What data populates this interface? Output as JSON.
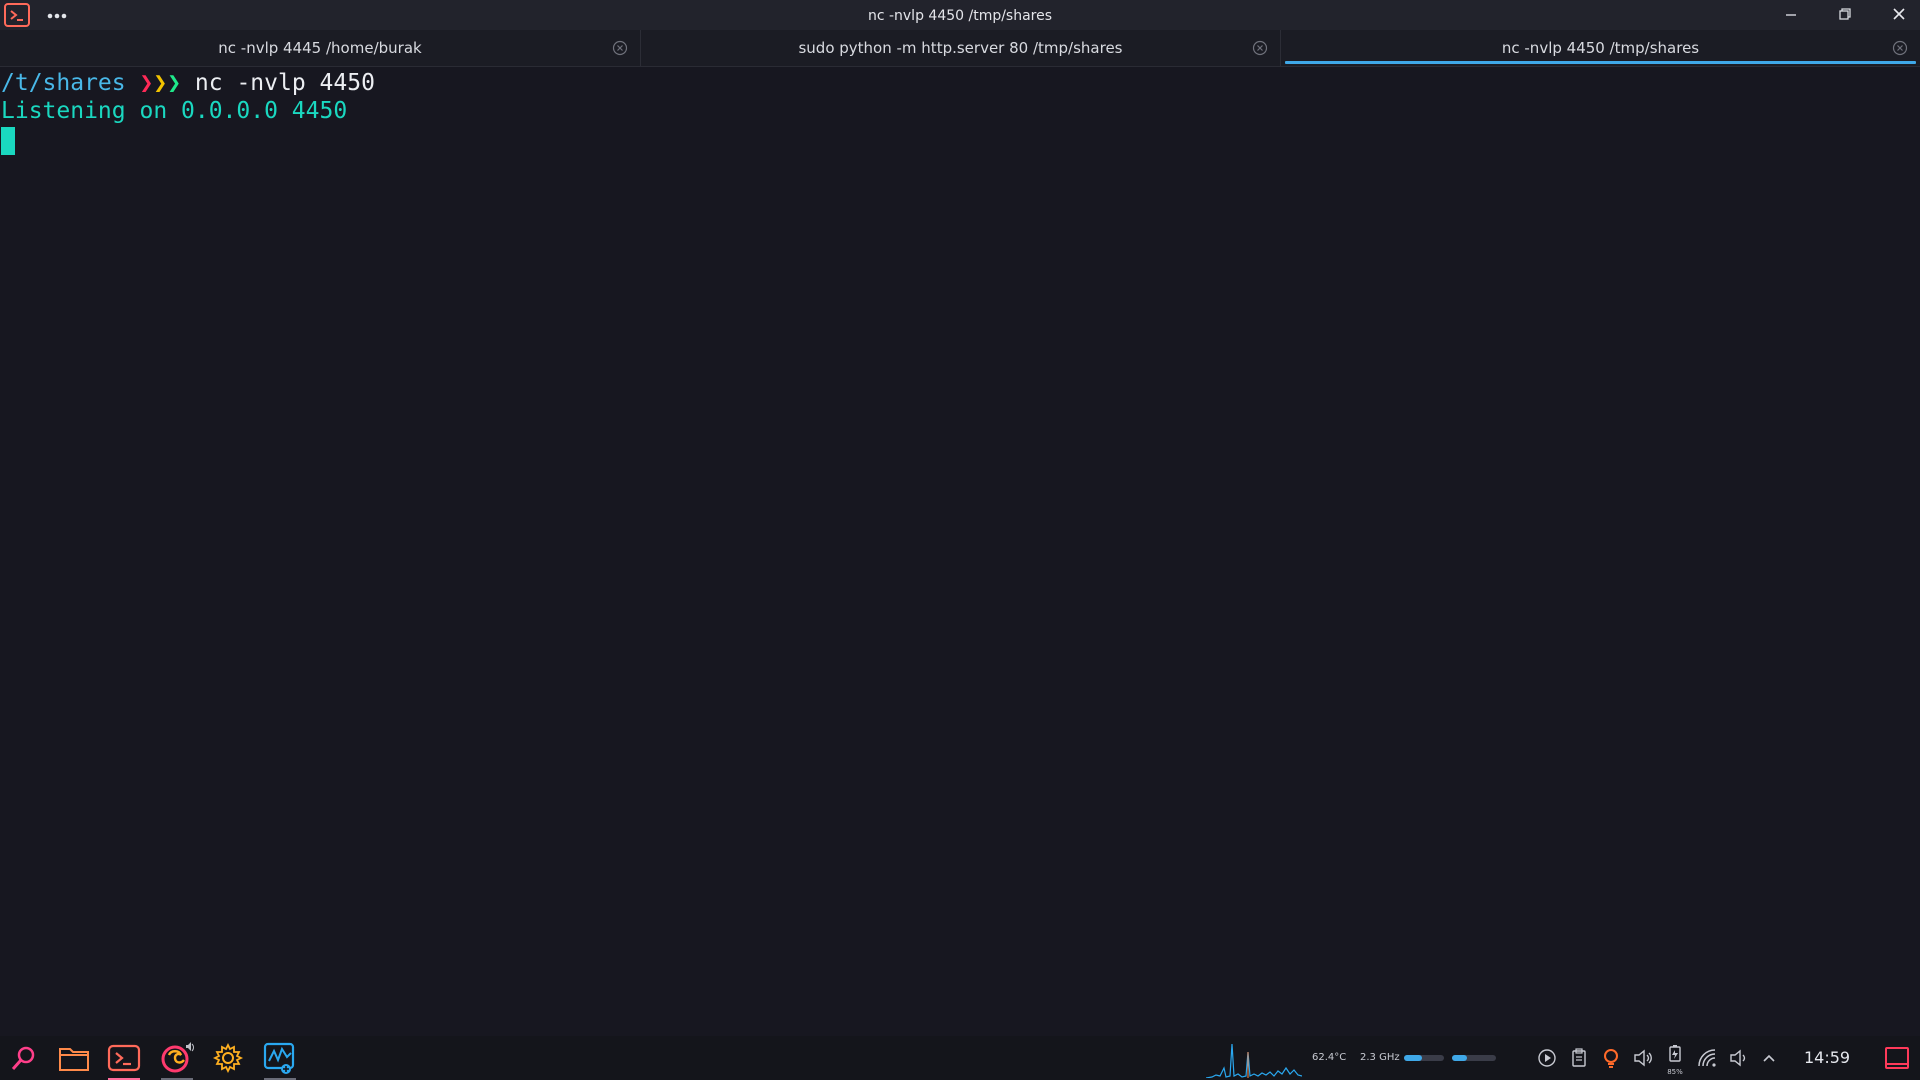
{
  "window": {
    "title": "nc -nvlp 4450 /tmp/shares",
    "menu_icon": "dots-icon",
    "app_icon": "terminal-icon"
  },
  "tabs": [
    {
      "label": "nc -nvlp 4445 /home/burak",
      "active": false
    },
    {
      "label": "sudo python -m http.server 80 /tmp/shares",
      "active": false
    },
    {
      "label": "nc -nvlp 4450 /tmp/shares",
      "active": true
    }
  ],
  "terminal": {
    "prompt_path": "/t/shares",
    "prompt_glyphs": [
      "❯",
      "❯",
      "❯"
    ],
    "command": "nc -nvlp 4450",
    "output": "Listening on 0.0.0.0 4450"
  },
  "taskbar": {
    "apps": [
      "search-icon",
      "files-icon",
      "terminal-icon",
      "firefox-icon",
      "settings-icon",
      "system-monitor-icon"
    ],
    "temperature": "62.4°C",
    "cpu_freq": "2.3 GHz",
    "ram_usage_fraction": 0.45,
    "swap_usage_fraction": 0.35,
    "battery": "85%",
    "clock": "14:59"
  },
  "colors": {
    "accent": "#3fa8e8",
    "prompt_path": "#49b8e8",
    "output": "#1ad8c0",
    "chevron_red": "#ff2a57",
    "chevron_yellow": "#f2c300",
    "chevron_green": "#1fe88a"
  }
}
